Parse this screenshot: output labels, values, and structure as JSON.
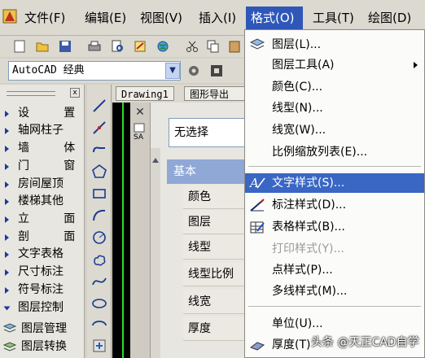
{
  "colors": {
    "menu_active": "#2f57b8",
    "menu_highlight": "#3a66c4",
    "group_header": "#8fa8d6"
  },
  "menubar": {
    "items": [
      {
        "label": "文件(F)"
      },
      {
        "label": "编辑(E)"
      },
      {
        "label": "视图(V)"
      },
      {
        "label": "插入(I)"
      },
      {
        "label": "格式(O)"
      },
      {
        "label": "工具(T)"
      },
      {
        "label": "绘图(D)"
      }
    ]
  },
  "toolbar": {
    "workspace": "AutoCAD 经典",
    "icons": [
      "new-file-icon",
      "open-folder-icon",
      "save-icon",
      "print-icon",
      "print-preview-icon",
      "publish-icon",
      "globe-icon",
      "cut-icon",
      "copy-icon"
    ]
  },
  "left_panel": {
    "items": [
      {
        "label": "设    置"
      },
      {
        "label": "轴网柱子"
      },
      {
        "label": "墙    体"
      },
      {
        "label": "门    窗"
      },
      {
        "label": "房间屋顶"
      },
      {
        "label": "楼梯其他"
      },
      {
        "label": "立    面"
      },
      {
        "label": "剖    面"
      },
      {
        "label": "文字表格"
      },
      {
        "label": "尺寸标注"
      },
      {
        "label": "符号标注"
      },
      {
        "label": "图层控制"
      },
      {
        "label": "图层管理"
      },
      {
        "label": "图层转换"
      }
    ]
  },
  "tabs": [
    {
      "label": "Drawing1"
    },
    {
      "label": "图形导出"
    }
  ],
  "properties": {
    "selection": "无选择",
    "group": "基本",
    "rows": [
      {
        "label": "颜色"
      },
      {
        "label": "图层"
      },
      {
        "label": "线型"
      },
      {
        "label": "线型比例"
      },
      {
        "label": "线宽"
      },
      {
        "label": "厚度"
      }
    ]
  },
  "format_menu": {
    "items": [
      {
        "label": "图层(L)...",
        "icon": "layers-icon"
      },
      {
        "label": "图层工具(A)",
        "submenu": true
      },
      {
        "label": "颜色(C)..."
      },
      {
        "label": "线型(N)..."
      },
      {
        "label": "线宽(W)..."
      },
      {
        "label": "比例缩放列表(E)..."
      },
      {
        "label": "文字样式(S)...",
        "icon": "text-style-icon",
        "highlighted": true
      },
      {
        "label": "标注样式(D)...",
        "icon": "dimension-style-icon"
      },
      {
        "label": "表格样式(B)...",
        "icon": "table-style-icon"
      },
      {
        "label": "打印样式(Y)...",
        "disabled": true
      },
      {
        "label": "点样式(P)..."
      },
      {
        "label": "多线样式(M)..."
      },
      {
        "label": "单位(U)..."
      },
      {
        "label": "厚度(T)",
        "icon": "thickness-icon"
      }
    ]
  },
  "watermark": "头条 @天正CAD自学"
}
